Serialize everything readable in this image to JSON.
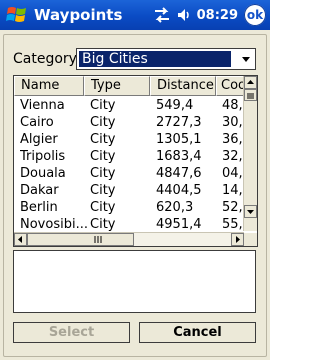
{
  "titlebar": {
    "title": "Waypoints",
    "time": "08:29",
    "ok_label": "ok"
  },
  "category": {
    "label": "Category:",
    "selected": "Big Cities"
  },
  "list": {
    "columns": [
      "Name",
      "Type",
      "Distance",
      "Coords"
    ],
    "rows": [
      {
        "name": "Vienna",
        "type": "City",
        "distance": "549,4",
        "coords": "48,"
      },
      {
        "name": "Cairo",
        "type": "City",
        "distance": "2727,3",
        "coords": "30,"
      },
      {
        "name": "Algier",
        "type": "City",
        "distance": "1305,1",
        "coords": "36,"
      },
      {
        "name": "Tripolis",
        "type": "City",
        "distance": "1683,4",
        "coords": "32,"
      },
      {
        "name": "Douala",
        "type": "City",
        "distance": "4847,6",
        "coords": "04,"
      },
      {
        "name": "Dakar",
        "type": "City",
        "distance": "4404,5",
        "coords": "14,"
      },
      {
        "name": "Berlin",
        "type": "City",
        "distance": "620,3",
        "coords": "52,"
      },
      {
        "name": "Novosibi...",
        "type": "City",
        "distance": "4951,4",
        "coords": "55,"
      }
    ]
  },
  "buttons": {
    "select": "Select",
    "cancel": "Cancel"
  },
  "colors": {
    "titlebar": "#0a4bc4",
    "selection": "#0a246a",
    "dialog": "#ece9d8"
  }
}
